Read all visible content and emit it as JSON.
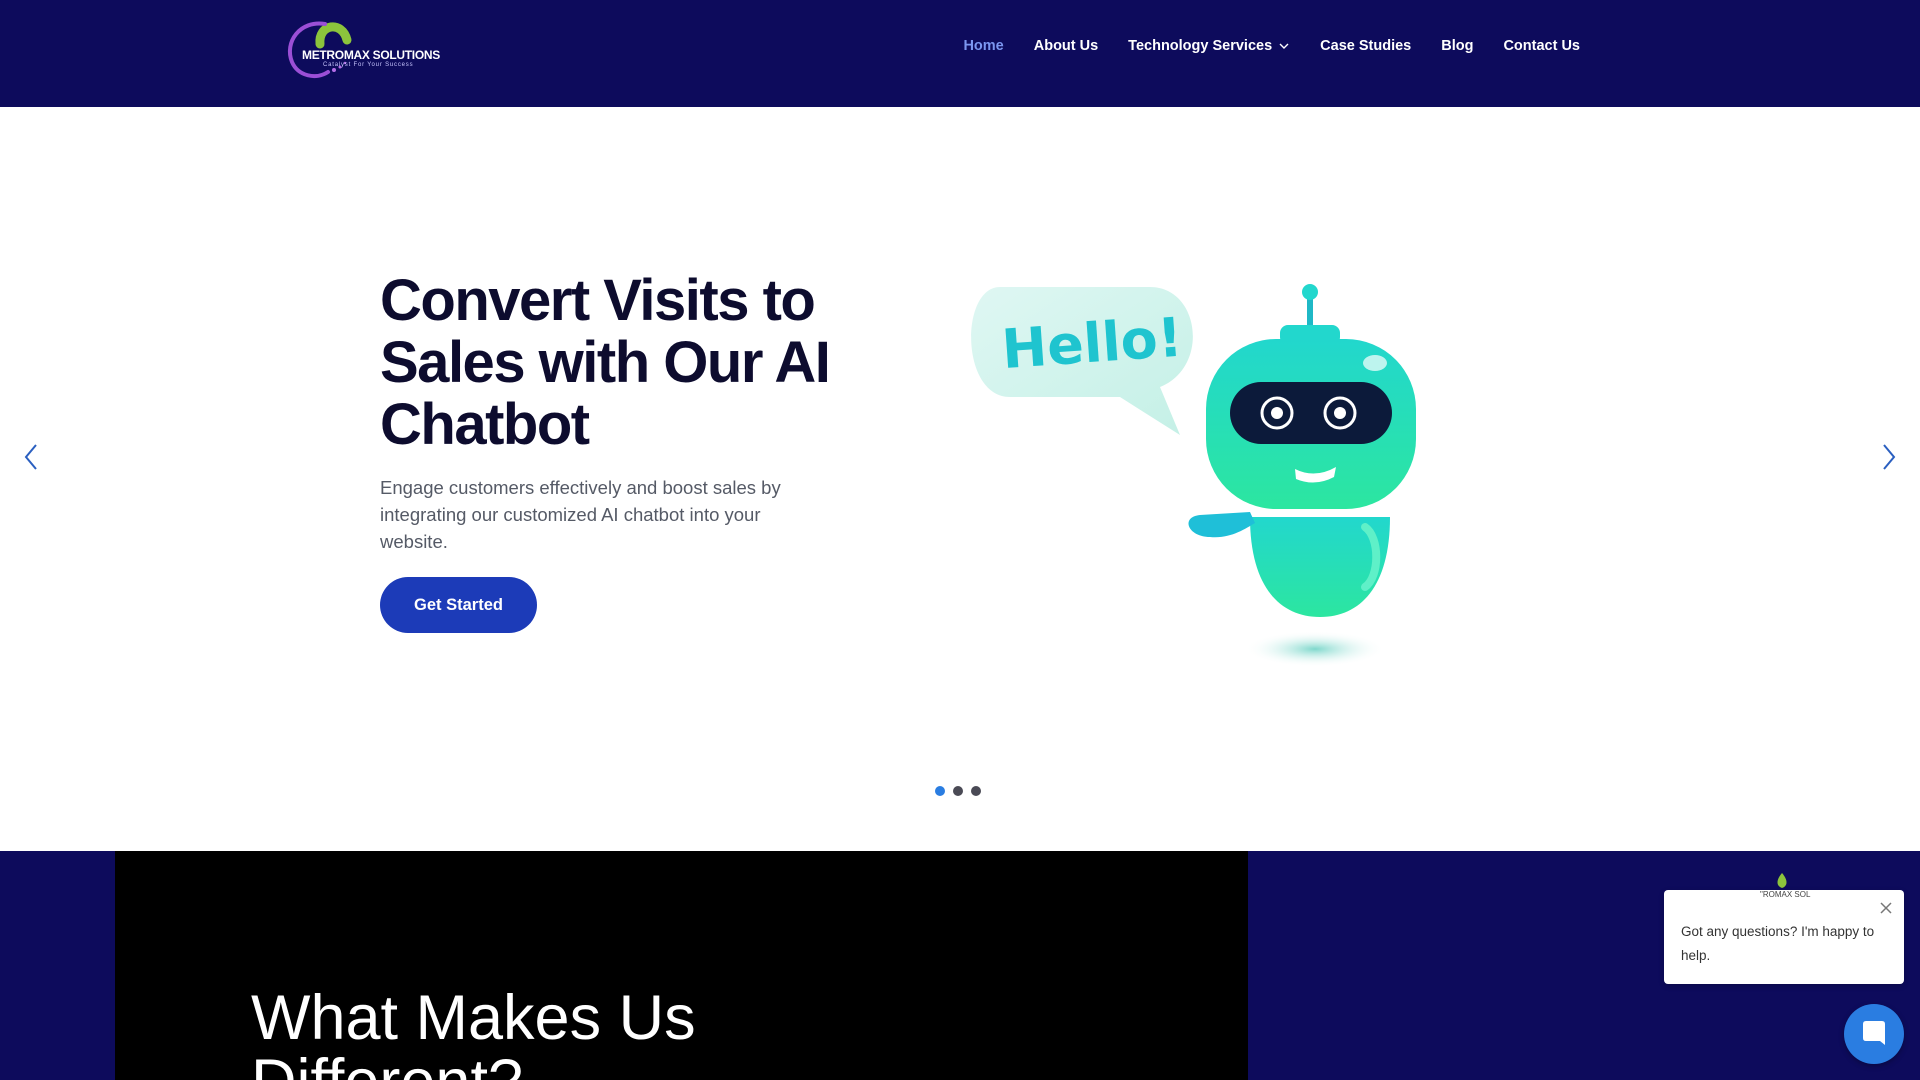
{
  "brand": {
    "name": "METROMAX SOLUTIONS",
    "tagline": "Catalyst For Your Success"
  },
  "nav": {
    "items": [
      {
        "label": "Home",
        "active": true
      },
      {
        "label": "About Us"
      },
      {
        "label": "Technology Services",
        "icon": "chevron-down-icon"
      },
      {
        "label": "Case Studies"
      },
      {
        "label": "Blog"
      },
      {
        "label": "Contact Us"
      }
    ]
  },
  "hero": {
    "title": "Convert Visits to Sales with Our AI Chatbot",
    "subtitle": "Engage customers effectively and boost sales by integrating our customized AI chatbot into your website.",
    "cta_label": "Get Started",
    "bubble_text": "Hello!",
    "slides_total": 3,
    "active_slide": 1
  },
  "section": {
    "title": "What Makes Us Different?"
  },
  "chat": {
    "logo_text": "\"ROMAX SOL",
    "message": "Got any questions? I'm happy to help."
  },
  "colors": {
    "header_bg": "#0d0b5c",
    "nav_active": "#7b96f0",
    "cta_bg": "#1c3bb8",
    "chat_accent": "#2a7de1",
    "robot_from": "#22d7cd",
    "robot_to": "#2ce6a0"
  }
}
